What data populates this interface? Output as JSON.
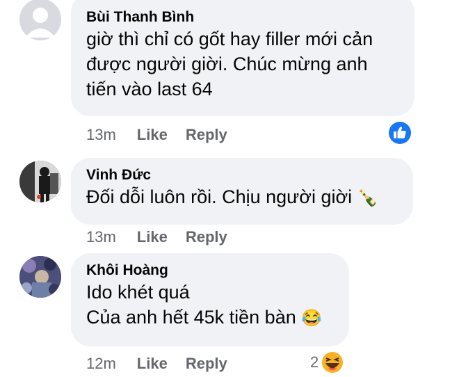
{
  "comments": [
    {
      "author": "Bùi Thanh Bình",
      "lines": [
        "giờ thì chỉ có gốt hay filler mới cản",
        "được người giời. Chúc mừng anh",
        "tiến vào last 64"
      ],
      "time": "13m",
      "like_label": "Like",
      "reply_label": "Reply",
      "reaction_icon": "like-reaction-icon",
      "reaction_count": ""
    },
    {
      "author": "Vinh Đức",
      "lines": [
        "Đối dỗi luôn rồi. Chịu người giời"
      ],
      "emoji": "🍾",
      "time": "13m",
      "like_label": "Like",
      "reply_label": "Reply"
    },
    {
      "author": "Khôi Hoàng",
      "lines": [
        "Ido khét quá",
        "Của anh hết 45k tiền bàn"
      ],
      "emoji": "😂",
      "time": "12m",
      "like_label": "Like",
      "reply_label": "Reply",
      "reaction_icon": "haha-reaction-icon",
      "reaction_count": "2"
    }
  ],
  "colors": {
    "bubble": "#f0f2f5",
    "meta": "#65676b",
    "like_blue": "#1877f2",
    "haha_yellow": "#f7b125"
  }
}
